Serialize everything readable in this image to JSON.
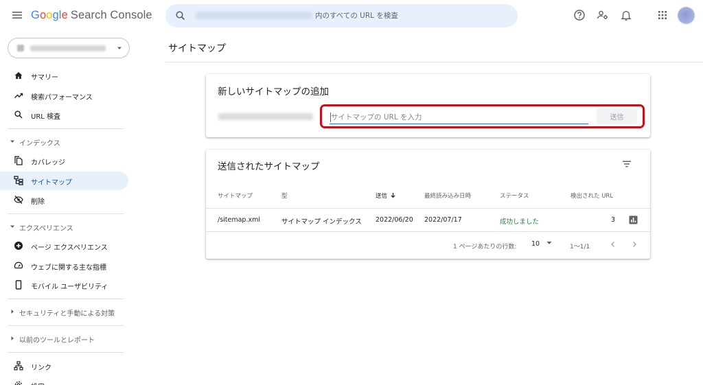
{
  "header": {
    "logo": {
      "g1": "G",
      "o1": "o",
      "o2": "o",
      "g2": "g",
      "l": "l",
      "e": "e",
      "product": "Search Console"
    },
    "search_placeholder": "内のすべての URL を検査",
    "icons": [
      "menu-icon",
      "search-icon",
      "help-icon",
      "admin-users-icon",
      "notifications-bell-icon",
      "apps-grid-icon"
    ]
  },
  "sidebar": {
    "items": [
      {
        "label": "サマリー",
        "icon": "home-icon"
      },
      {
        "label": "検索パフォーマンス",
        "icon": "trending-up-icon"
      },
      {
        "label": "URL 検査",
        "icon": "search-icon"
      }
    ],
    "sections": [
      {
        "label": "インデックス",
        "items": [
          {
            "label": "カバレッジ",
            "icon": "copy-pages-icon"
          },
          {
            "label": "サイトマップ",
            "icon": "sitemap-icon",
            "active": true
          },
          {
            "label": "削除",
            "icon": "visibility-off-icon"
          }
        ]
      },
      {
        "label": "エクスペリエンス",
        "items": [
          {
            "label": "ページ エクスペリエンス",
            "icon": "add-circle-icon"
          },
          {
            "label": "ウェブに関する主な指標",
            "icon": "speed-gauge-icon"
          },
          {
            "label": "モバイル ユーザビリティ",
            "icon": "smartphone-icon"
          }
        ]
      }
    ],
    "collapsed": [
      {
        "label": "セキュリティと手動による対策"
      },
      {
        "label": "以前のツールとレポート"
      }
    ],
    "bottom": [
      {
        "label": "リンク",
        "icon": "links-tree-icon"
      },
      {
        "label": "設定",
        "icon": "settings-icon"
      }
    ]
  },
  "main": {
    "page_title": "サイトマップ",
    "add_card": {
      "title": "新しいサイトマップの追加",
      "input_placeholder": "サイトマップの URL を入力",
      "submit_label": "送信"
    },
    "list_card": {
      "title": "送信されたサイトマップ",
      "columns": [
        "サイトマップ",
        "型",
        "送信",
        "最終読み込み日時",
        "ステータス",
        "検出された URL"
      ],
      "rows": [
        {
          "sitemap": "/sitemap.xml",
          "type": "サイトマップ インデックス",
          "submitted": "2022/06/20",
          "last_read": "2022/07/17",
          "status": "成功しました",
          "urls": "3"
        }
      ],
      "pagination": {
        "rows_per_page_label": "1 ページあたりの行数:",
        "rows_per_page": "10",
        "range": "1〜1/1"
      }
    }
  },
  "colors": {
    "accent": "#1a73e8",
    "highlight_box": "#c5101a",
    "success": "#1e8e3e",
    "active_nav_bg": "#e8f0fe"
  }
}
